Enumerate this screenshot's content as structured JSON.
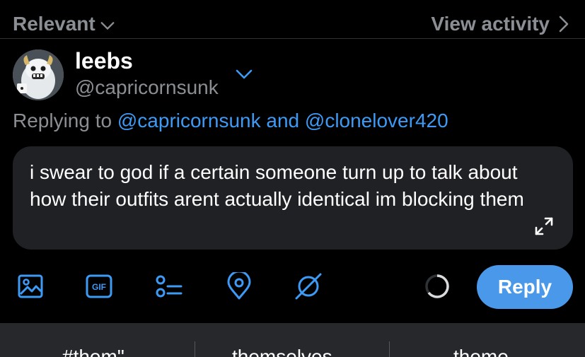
{
  "header": {
    "sort_label": "Relevant",
    "view_activity_label": "View activity"
  },
  "account": {
    "name": "leebs",
    "handle": "@capricornsunk"
  },
  "replying": {
    "prefix": "Replying to ",
    "mention1": "@capricornsunk",
    "joiner": " and ",
    "mention2": "@clonelover420"
  },
  "composer": {
    "text": "i swear to god if a certain someone turn up to talk about how their outfits arent actually identical im blocking them"
  },
  "toolbar": {
    "tools": [
      "image-icon",
      "gif-icon",
      "poll-icon",
      "location-icon",
      "grok-icon"
    ],
    "gif_label": "GIF",
    "reply_label": "Reply"
  },
  "suggestions": [
    "#them\"",
    "themselves",
    "theme"
  ],
  "colors": {
    "background": "#000000",
    "composer_bg": "#202125",
    "accent": "#3d9af5",
    "reply_button": "#4a98e9",
    "muted_text": "#8b8f94",
    "suggest_bar": "#26282b"
  }
}
